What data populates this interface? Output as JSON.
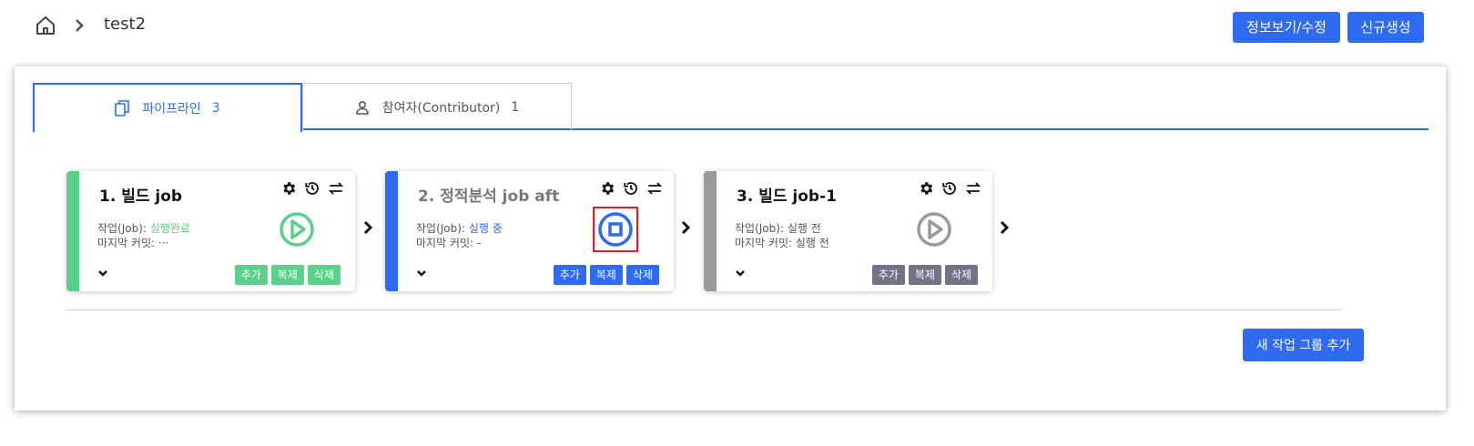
{
  "breadcrumb": {
    "current": "test2"
  },
  "header": {
    "edit_button": "정보보기/수정",
    "new_button": "신규생성"
  },
  "tabs": [
    {
      "label": "파이프라인",
      "count": "3",
      "icon": "document-copy-icon"
    },
    {
      "label": "참여자(Contributor)",
      "count": "1",
      "icon": "user-icon"
    }
  ],
  "jobs": [
    {
      "title": "1. 빌드 job",
      "job_label": "작업(Job): ",
      "status": "실행완료",
      "last_commit_label": "마지막 커밋: ",
      "last_commit": "···",
      "run_icon": "play-circle-icon",
      "accent": "#5ad08a",
      "status_color": "#5ad08a",
      "actions": [
        "추가",
        "복제",
        "삭제"
      ]
    },
    {
      "title": "2. 정적분석 job aft",
      "job_label": "작업(Job): ",
      "status": "실행 중",
      "last_commit_label": "마지막 커밋: ",
      "last_commit": " -",
      "run_icon": "stop-circle-icon",
      "accent": "#2f6bf0",
      "status_color": "#2f6bf0",
      "actions": [
        "추가",
        "복제",
        "삭제"
      ]
    },
    {
      "title": "3. 빌드 job-1",
      "job_label": "작업(Job): ",
      "status": "실행 전",
      "last_commit_label": "마지막 커밋: ",
      "last_commit": " 실행 전",
      "run_icon": "play-circle-icon",
      "accent": "#9a9a9a",
      "status_color": "#555555",
      "actions": [
        "추가",
        "복제",
        "삭제"
      ]
    }
  ],
  "add_group_button": "새 작업 그룹 추가",
  "colors": {
    "primary": "#2f6bf0",
    "success": "#5ad08a",
    "idle": "#9a9a9a",
    "idle_button": "#6f7487",
    "highlight": "#e02020"
  }
}
